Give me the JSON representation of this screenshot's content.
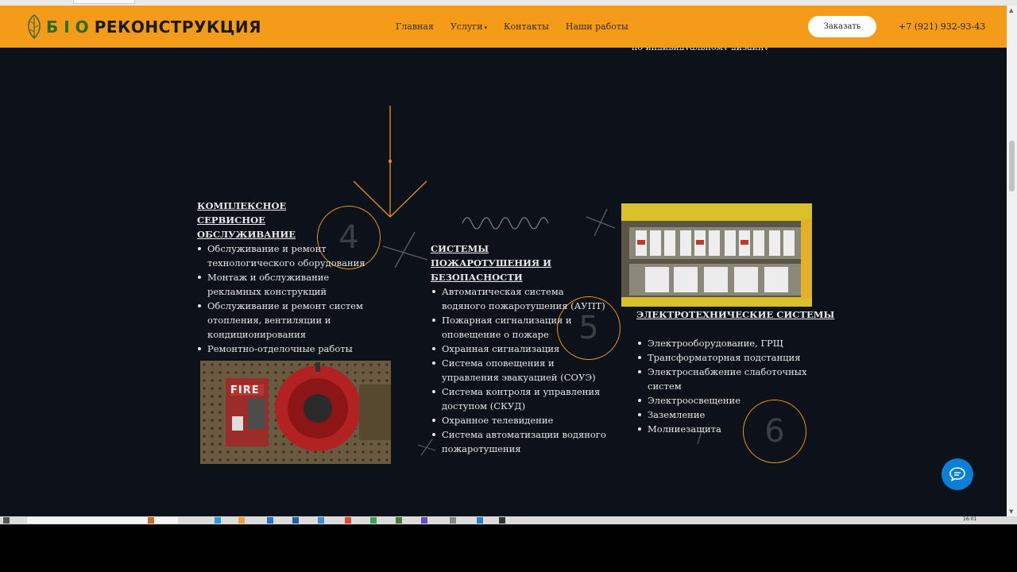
{
  "header": {
    "logo_bio": "БІО",
    "logo_rest": "РЕКОНСТРУКЦИЯ",
    "nav": [
      "Главная",
      "Услуги",
      "Контакты",
      "Наши работы"
    ],
    "order_button": "Заказать",
    "phone": "+7 (921) 932-93-43"
  },
  "partial_text": "по индивидуальному дизайну",
  "columns": [
    {
      "number": "4",
      "title": "КОМПЛЕКСНОЕ СЕРВИСНОЕ ОБСЛУЖИВАНИЕ",
      "items": [
        "Обслуживание и ремонт технологического оборудования",
        "Монтаж и обслуживание рекламных конструкций",
        "Обслуживание и ремонт систем отопления, вентиляции и кондиционирования",
        "Ремонтно-отделочные работы"
      ],
      "photo_label": "FIRE"
    },
    {
      "number": "5",
      "title": "СИСТЕМЫ ПОЖАРОТУШЕНИЯ И БЕЗОПАСНОСТИ",
      "items": [
        "Автоматическая система водяного пожаротушения (АУПТ)",
        "Пожарная сигнализация и оповещение о пожаре",
        "Охранная сигнализация",
        "Система оповещения и управления эвакуацией (СОУЭ)",
        "Система контроля и управления доступом (СКУД)",
        "Охранное телевидение",
        "Система автоматизации водяного пожаротушения"
      ]
    },
    {
      "number": "6",
      "title": "ЭЛЕКТРОТЕХНИЧЕСКИЕ СИСТЕМЫ",
      "items": [
        "Электрооборудование, ГРЩ",
        "Трансформаторная подстанция",
        "Электроснабжение слаботочных систем",
        "Электроосвещение",
        "Заземление",
        "Молниезащита"
      ]
    }
  ],
  "taskbar": {
    "clock": "16:01"
  },
  "colors": {
    "accent": "#f49c1a",
    "page_bg": "#0d1119",
    "chat_button": "#0a7fd8"
  },
  "icons": {
    "chat": "chat-bubble-icon",
    "logo": "leaf-icon"
  }
}
